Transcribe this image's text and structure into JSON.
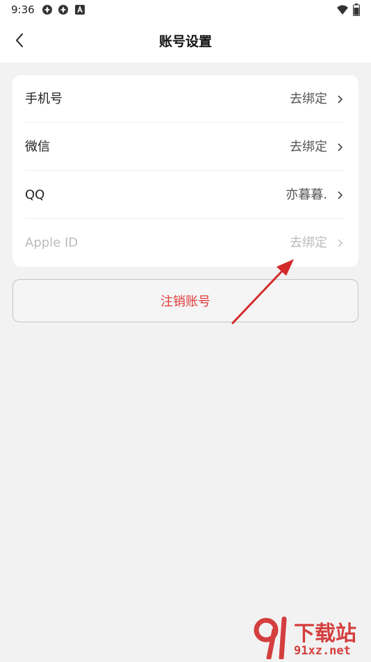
{
  "status_bar": {
    "time": "9:36",
    "icons": [
      "app-notification-icon",
      "app-notification-icon",
      "a-badge-icon",
      "wifi-icon",
      "battery-icon"
    ]
  },
  "header": {
    "title": "账号设置",
    "back_icon": "chevron-left-icon"
  },
  "accounts": {
    "rows": [
      {
        "label": "手机号",
        "value": "去绑定",
        "disabled": false
      },
      {
        "label": "微信",
        "value": "去绑定",
        "disabled": false
      },
      {
        "label": "QQ",
        "value": "亦暮暮.",
        "disabled": false
      },
      {
        "label": "Apple ID",
        "value": "去绑定",
        "disabled": true
      }
    ]
  },
  "cancel_account": {
    "label": "注销账号"
  },
  "colors": {
    "danger": "#e03a3a",
    "annotation_arrow": "#d42a2a",
    "watermark": "#d43e3e"
  },
  "watermark": {
    "brand_top": "下载站",
    "brand_bottom": "91xz.net"
  }
}
